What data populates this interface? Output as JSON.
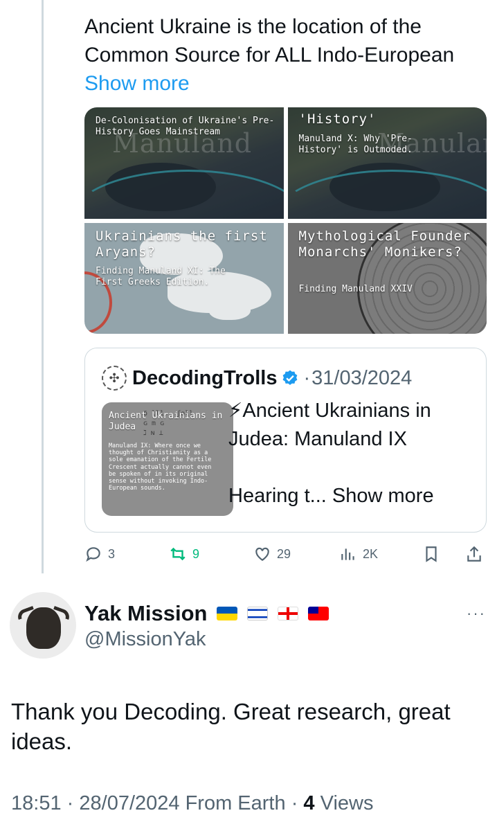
{
  "post": {
    "text": "Ancient Ukraine is the location of the Common Source for ALL Indo-European",
    "show_more": "Show more"
  },
  "media": [
    {
      "caption": "De-Colonisation of Ukraine's Pre-History Goes Mainstream",
      "watermark": "Manuland"
    },
    {
      "title": "'History'",
      "caption": "Manuland X: Why 'Pre-History' is Outmoded.",
      "watermark": "Manuland"
    },
    {
      "title": "Ukrainians the first Aryans?",
      "caption": "Finding Manuland XI: The First Greeks Edition."
    },
    {
      "title": "Mythological Founder Monarchs' Monikers?",
      "caption": "Finding Manuland XXIV"
    }
  ],
  "quote": {
    "author": "DecodingTrolls",
    "date": "31/03/2024",
    "separator": "·",
    "thumb_title": "Ancient Ukrainians in Judea",
    "thumb_text": "Manuland IX: Where once we thought of Christianity as a sole emanation of the Fertile Crescent actually cannot even be spoken of in its original sense without invoking Indo-European sounds.",
    "text_line1": "⚡Ancient Ukrainians in Judea: Manuland IX",
    "text_line2": "Hearing t...",
    "show_more": "Show more"
  },
  "actions": {
    "replies": "3",
    "retweets": "9",
    "likes": "29",
    "views": "2K"
  },
  "reply": {
    "name": "Yak Mission",
    "handle": "@MissionYak",
    "text": "Thank you Decoding. Great research, great ideas.",
    "time": "18:51",
    "date": "28/07/2024",
    "source": "From Earth",
    "views_count": "4",
    "views_label": "Views",
    "dot": "·",
    "more": "···"
  },
  "colors": {
    "link": "#1d9bf0",
    "muted": "#536471",
    "retweet": "#00ba7c",
    "verified": "#1d9bf0"
  }
}
